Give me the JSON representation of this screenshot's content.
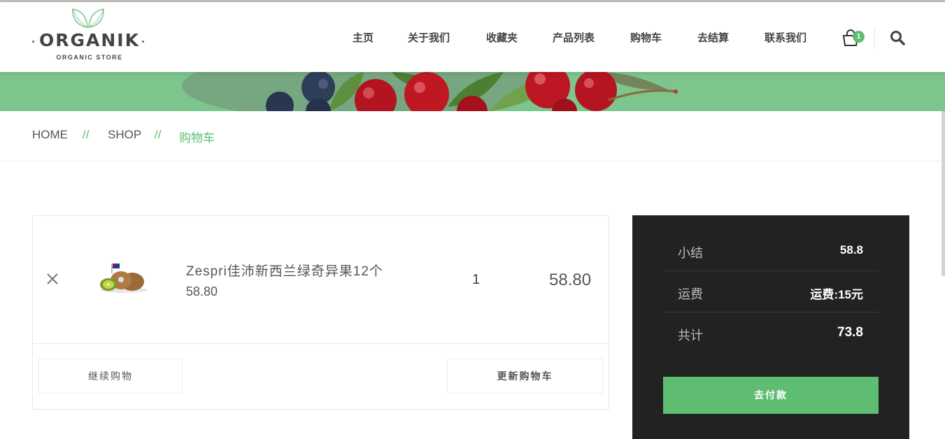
{
  "colors": {
    "accent": "#5fbd72",
    "banner": "#7cc58d",
    "totals_bg": "#222222"
  },
  "logo": {
    "brand": "ORGANIK",
    "tagline": "ORGANIC STORE",
    "icon": "leaf-icon"
  },
  "nav": {
    "items": [
      {
        "label": "主页"
      },
      {
        "label": "关于我们"
      },
      {
        "label": "收藏夹"
      },
      {
        "label": "产品列表"
      },
      {
        "label": "购物车"
      },
      {
        "label": "去结算"
      },
      {
        "label": "联系我们"
      }
    ],
    "cart_icon": "shopping-bag-icon",
    "cart_count": "1",
    "search_icon": "search-icon"
  },
  "breadcrumb": {
    "home": "HOME",
    "sep": "//",
    "shop": "SHOP",
    "current": "购物车"
  },
  "cart": {
    "remove_icon": "close-icon",
    "items": [
      {
        "name": "Zespri佳沛新西兰绿奇异果12个",
        "price": "58.80",
        "quantity": "1",
        "total": "58.80"
      }
    ],
    "continue_label": "继续购物",
    "update_label": "更新购物车"
  },
  "totals": {
    "subtotal_label": "小结",
    "subtotal_value": "58.8",
    "shipping_label": "运费",
    "shipping_value": "运费:15元",
    "total_label": "共计",
    "total_value": "73.8",
    "checkout_label": "去付款"
  }
}
